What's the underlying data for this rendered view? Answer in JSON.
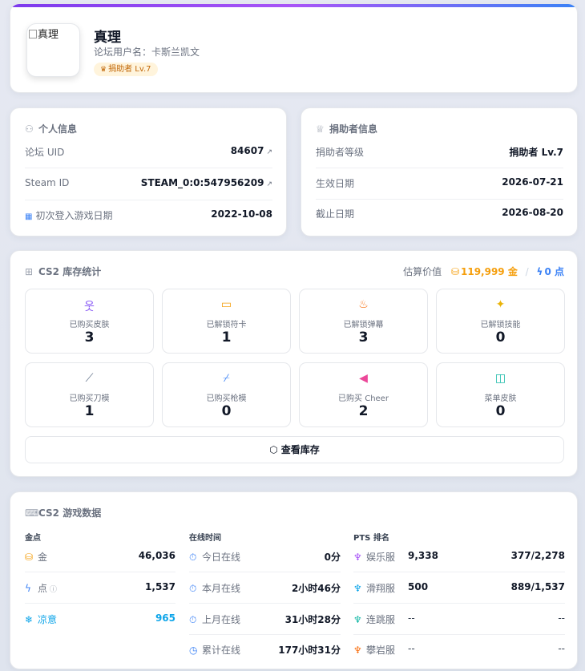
{
  "profile": {
    "avatar_alt": "真理",
    "name": "真理",
    "forum_username": "论坛用户名：卡斯兰凯文",
    "badge": "捐助者 Lv.7"
  },
  "personal": {
    "title": "个人信息",
    "rows": [
      {
        "label": "论坛 UID",
        "value": "84607"
      },
      {
        "label": "Steam ID",
        "value": "STEAM_0:0:547956209"
      },
      {
        "label": "初次登入游戏日期",
        "value": "2022-10-08"
      }
    ]
  },
  "donor": {
    "title": "捐助者信息",
    "rows": [
      {
        "label": "捐助者等级",
        "value": "捐助者 Lv.7"
      },
      {
        "label": "生效日期",
        "value": "2026-07-21"
      },
      {
        "label": "截止日期",
        "value": "2026-08-20"
      }
    ]
  },
  "inventory": {
    "title": "CS2 库存统计",
    "est_label": "估算价值",
    "gold_value": "119,999 金",
    "separator": "/",
    "points_value": "0 点",
    "tiles": [
      {
        "label": "已购买皮肤",
        "value": "3",
        "icon": "person-icon",
        "color": "#8b5cf6"
      },
      {
        "label": "已解锁符卡",
        "value": "1",
        "icon": "card-icon",
        "color": "#f59e0b"
      },
      {
        "label": "已解锁弹幕",
        "value": "3",
        "icon": "flame-icon",
        "color": "#f97316"
      },
      {
        "label": "已解锁技能",
        "value": "0",
        "icon": "sparkle-icon",
        "color": "#eab308"
      },
      {
        "label": "已购买刀模",
        "value": "1",
        "icon": "knife-icon",
        "color": "#64748b"
      },
      {
        "label": "已购买枪模",
        "value": "0",
        "icon": "gun-icon",
        "color": "#3b82f6"
      },
      {
        "label": "已购买 Cheer",
        "value": "2",
        "icon": "megaphone-icon",
        "color": "#ec4899"
      },
      {
        "label": "菜单皮肤",
        "value": "0",
        "icon": "panel-icon",
        "color": "#14b8a6"
      }
    ],
    "button": "查看库存"
  },
  "game": {
    "title": "CS2 游戏数据",
    "gold": {
      "header": "金点",
      "rows": [
        {
          "label": "金",
          "value": "46,036"
        },
        {
          "label": "点",
          "value": "1,537"
        },
        {
          "label": "凉意",
          "value": "965"
        }
      ]
    },
    "online": {
      "header": "在线时间",
      "rows": [
        {
          "label": "今日在线",
          "value": "0分"
        },
        {
          "label": "本月在线",
          "value": "2小时46分"
        },
        {
          "label": "上月在线",
          "value": "31小时28分"
        },
        {
          "label": "累计在线",
          "value": "177小时31分"
        }
      ]
    },
    "pts": {
      "header": "PTS 排名",
      "rows": [
        {
          "label": "娱乐服",
          "score": "9,338",
          "rank": "377/2,278"
        },
        {
          "label": "滑翔服",
          "score": "500",
          "rank": "889/1,537"
        },
        {
          "label": "连跳服",
          "score": "--",
          "rank": "--"
        },
        {
          "label": "攀岩服",
          "score": "--",
          "rank": "--"
        }
      ]
    }
  },
  "colors": {
    "accent": "#7c3aed",
    "gold": "#f59e0b",
    "points": "#3b82f6",
    "cool": "#0ea5e9"
  }
}
